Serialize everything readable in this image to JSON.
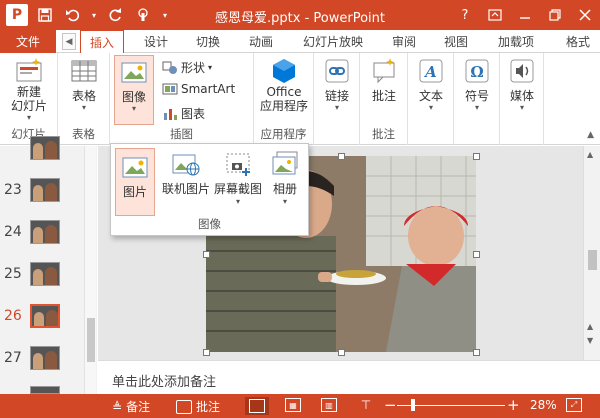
{
  "app": {
    "title": "感恩母爱.pptx - PowerPoint",
    "icon_letter": "P",
    "qat": {
      "save_icon": "save-icon",
      "undo_icon": "undo-icon",
      "redo_icon": "redo-icon",
      "touch_icon": "touch-mode-icon"
    },
    "window_controls": [
      "help-icon",
      "ribbon-display-icon",
      "minimize-icon",
      "restore-icon",
      "close-icon"
    ],
    "help_glyph": "?"
  },
  "tabs": {
    "file": "文件",
    "items": [
      "插入",
      "设计",
      "切换",
      "动画",
      "幻灯片放映",
      "审阅",
      "视图",
      "加载项",
      "格式"
    ],
    "active": "插入"
  },
  "ribbon": {
    "groups": {
      "slides": {
        "label": "幻灯片",
        "new_slide_line1": "新建",
        "new_slide_line2": "幻灯片"
      },
      "tables": {
        "label": "表格",
        "table": "表格"
      },
      "images": {
        "label": "插图",
        "image": "图像",
        "shapes": "形状",
        "smartart": "SmartArt",
        "chart": "图表"
      },
      "apps": {
        "label": "应用程序",
        "office_line1": "Office",
        "office_line2": "应用程序"
      },
      "links": {
        "label": "",
        "link": "链接"
      },
      "comments": {
        "label": "批注",
        "comment": "批注"
      },
      "text": {
        "label": "",
        "text": "文本"
      },
      "symbols": {
        "label": "",
        "symbol": "符号"
      },
      "media": {
        "label": "",
        "media": "媒体"
      }
    }
  },
  "dropdown": {
    "group_label": "图像",
    "items": [
      "图片",
      "联机图片",
      "屏幕截图",
      "相册"
    ]
  },
  "slides": {
    "numbers": [
      "23",
      "24",
      "25",
      "26",
      "27"
    ],
    "selected": "26"
  },
  "notes": {
    "placeholder": "单击此处添加备注"
  },
  "status": {
    "notes": "备注",
    "comments": "批注",
    "zoom": "28%"
  },
  "colors": {
    "accent": "#d24726",
    "selection": "#e0552f"
  }
}
